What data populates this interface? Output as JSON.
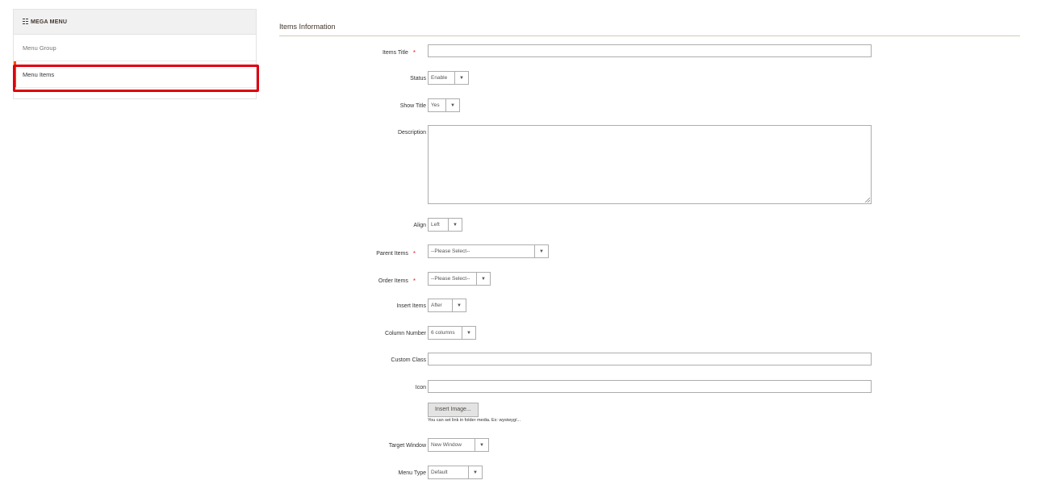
{
  "sidebar": {
    "header": "MEGA MENU",
    "items": [
      {
        "label": "Menu Group"
      },
      {
        "label": "Menu Items"
      }
    ]
  },
  "main": {
    "section_title": "Items Information",
    "fields": {
      "items_title": {
        "label": "Items Title",
        "value": ""
      },
      "status": {
        "label": "Status",
        "value": "Enable"
      },
      "show_title": {
        "label": "Show Title",
        "value": "Yes"
      },
      "description": {
        "label": "Description",
        "value": ""
      },
      "align": {
        "label": "Align",
        "value": "Left"
      },
      "parent_items": {
        "label": "Parent Items",
        "value": "--Please Select--"
      },
      "order_items": {
        "label": "Order Items",
        "value": "--Please Select--"
      },
      "insert_items": {
        "label": "Insert Items",
        "value": "After"
      },
      "column_number": {
        "label": "Column Number",
        "value": "6 columns"
      },
      "custom_class": {
        "label": "Custom Class",
        "value": ""
      },
      "icon": {
        "label": "Icon",
        "value": "",
        "button": "Insert Image...",
        "note": "You can set link in folder media. Ex: wysiwyg/..."
      },
      "target_window": {
        "label": "Target Window",
        "value": "New Window"
      },
      "menu_type": {
        "label": "Menu Type",
        "value": "Default"
      }
    },
    "required_marker": "*"
  },
  "colors": {
    "highlight": "#e0000d",
    "required": "#e22626",
    "active_accent": "#eb5202"
  }
}
